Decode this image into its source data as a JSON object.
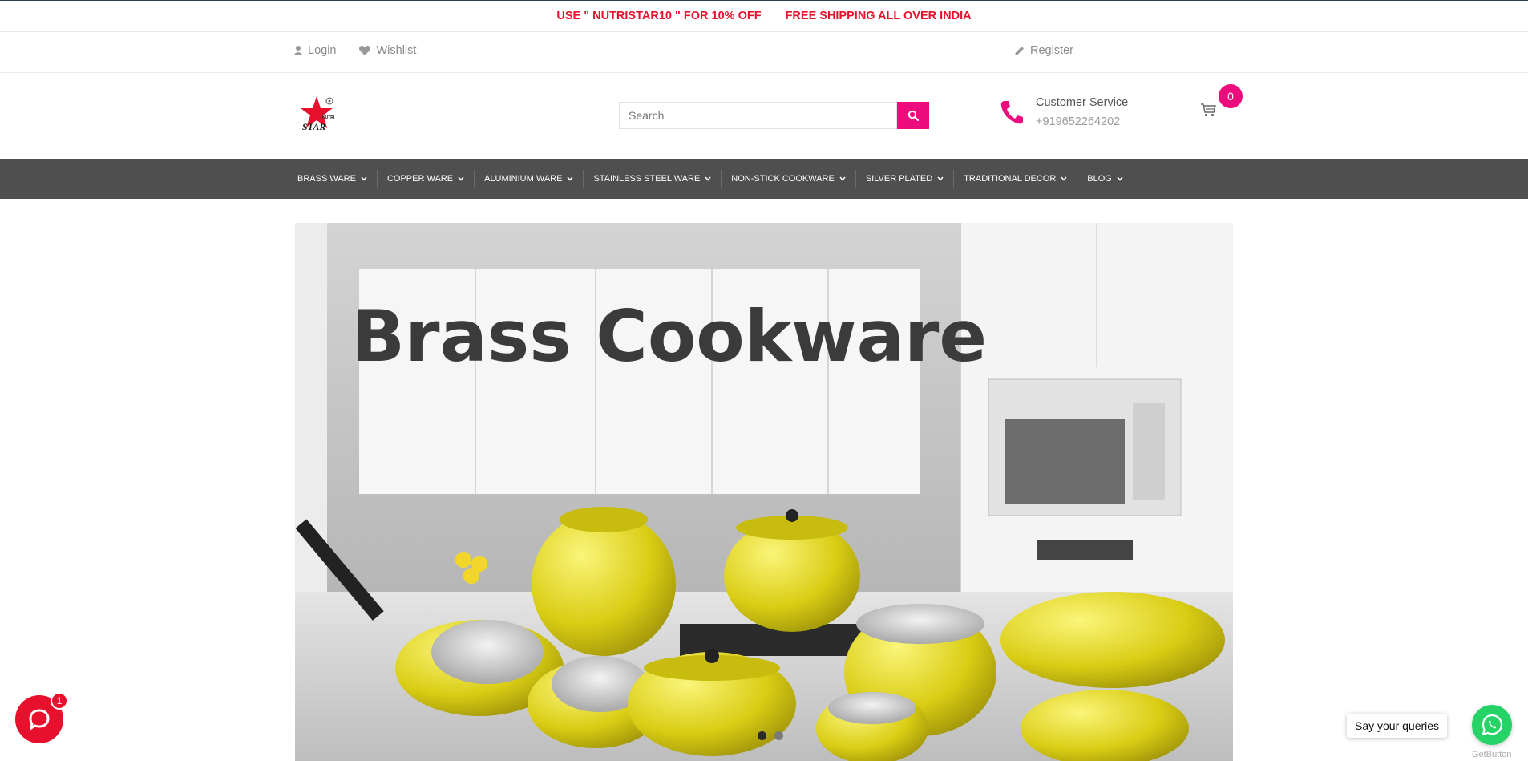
{
  "promo": {
    "coupon": "USE \" NUTRISTAR10 \" FOR 10% OFF",
    "shipping": "FREE SHIPPING ALL OVER INDIA"
  },
  "topbar": {
    "login": "Login",
    "wishlist": "Wishlist",
    "register": "Register"
  },
  "header": {
    "logo_text": "STAR",
    "logo_small": "NUTRI",
    "search_placeholder": "Search",
    "customer_service_label": "Customer Service",
    "customer_service_phone": "+919652264202",
    "cart_count": "0"
  },
  "nav": {
    "items": [
      {
        "label": "BRASS WARE"
      },
      {
        "label": "COPPER WARE"
      },
      {
        "label": "ALUMINIUM WARE"
      },
      {
        "label": "STAINLESS STEEL WARE"
      },
      {
        "label": "NON-STICK COOKWARE"
      },
      {
        "label": "SILVER PLATED"
      },
      {
        "label": "TRADITIONAL DECOR"
      },
      {
        "label": "BLOG"
      }
    ]
  },
  "hero": {
    "title": "Brass Cookware",
    "slide_count": 2,
    "active_slide": 1
  },
  "chat": {
    "badge": "1"
  },
  "whatsapp": {
    "tooltip": "Say your queries",
    "credit": "GetButton"
  },
  "colors": {
    "accent": "#ec0c7d",
    "promo_red": "#e8112d",
    "nav_bg": "#4f4f4f"
  }
}
